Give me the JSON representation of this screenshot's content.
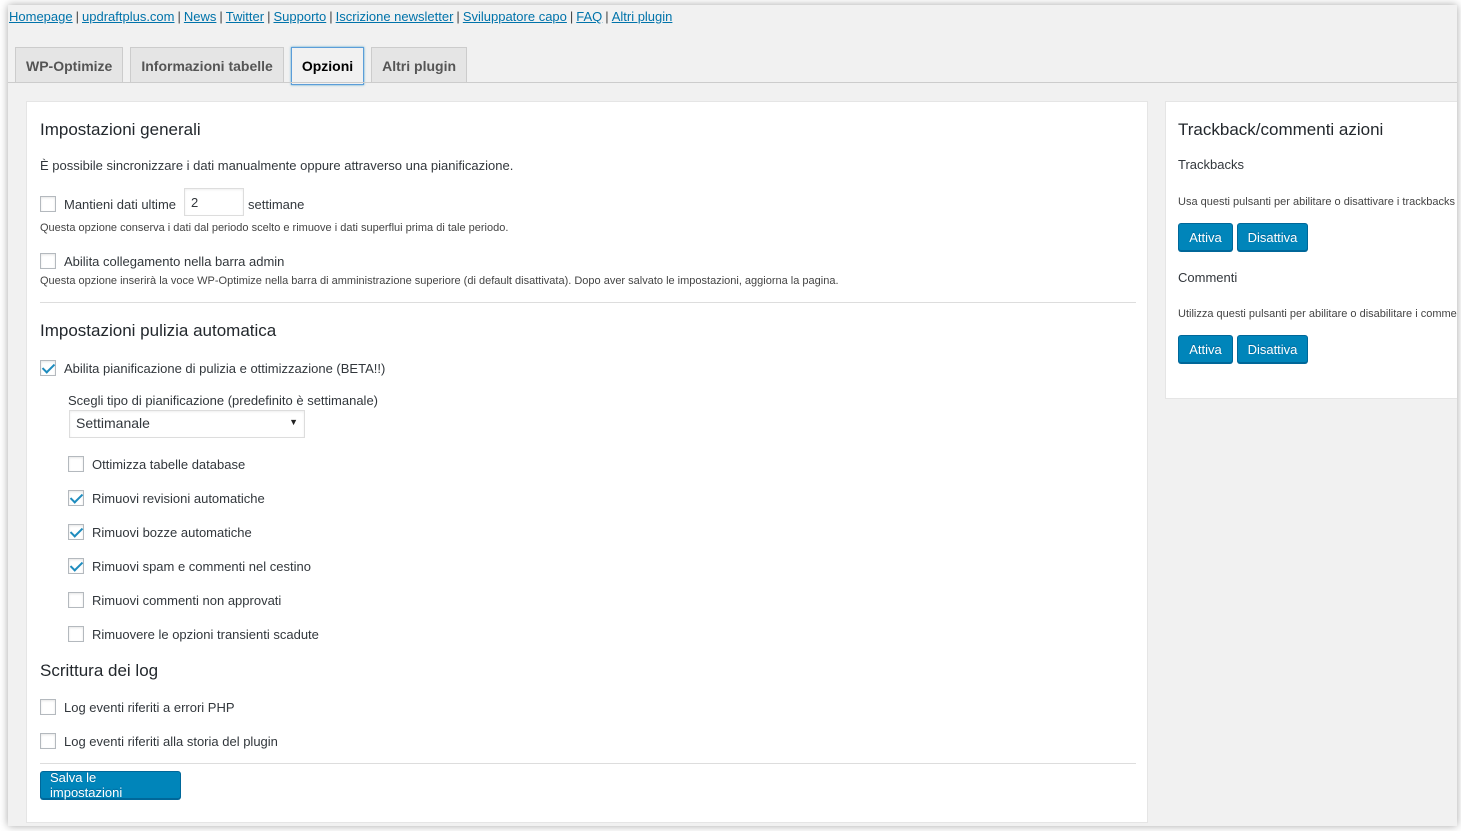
{
  "top_links": [
    "Homepage",
    "updraftplus.com",
    "News",
    "Twitter",
    "Supporto",
    "Iscrizione newsletter",
    "Sviluppatore capo",
    "FAQ",
    "Altri plugin"
  ],
  "tabs": [
    {
      "label": "WP-Optimize",
      "active": false
    },
    {
      "label": "Informazioni tabelle",
      "active": false
    },
    {
      "label": "Opzioni",
      "active": true
    },
    {
      "label": "Altri plugin",
      "active": false
    }
  ],
  "general": {
    "title": "Impostazioni generali",
    "intro": "È possibile sincronizzare i dati manualmente oppure attraverso una pianificazione.",
    "keep_prefix": "Mantieni dati ultime",
    "keep_value": "2",
    "keep_suffix": "settimane",
    "keep_desc": "Questa opzione conserva i dati dal periodo scelto e rimuove i dati superflui prima di tale periodo.",
    "admin_bar_label": "Abilita collegamento nella barra admin",
    "admin_bar_desc": "Questa opzione inserirà la voce WP-Optimize nella barra di amministrazione superiore (di default disattivata). Dopo aver salvato le impostazioni, aggiorna la pagina."
  },
  "auto": {
    "title": "Impostazioni pulizia automatica",
    "enable_label": "Abilita pianificazione di pulizia e ottimizzazione (BETA!!)",
    "schedule_label": "Scegli tipo di pianificazione (predefinito è settimanale)",
    "schedule_value": "Settimanale",
    "options": [
      {
        "label": "Ottimizza tabelle database",
        "checked": false
      },
      {
        "label": "Rimuovi revisioni automatiche",
        "checked": true
      },
      {
        "label": "Rimuovi bozze automatiche",
        "checked": true
      },
      {
        "label": "Rimuovi spam e commenti nel cestino",
        "checked": true
      },
      {
        "label": "Rimuovi commenti non approvati",
        "checked": false
      },
      {
        "label": "Rimuovere le opzioni transienti scadute",
        "checked": false
      }
    ]
  },
  "logging": {
    "title": "Scrittura dei log",
    "php_errors": "Log eventi riferiti a errori PHP",
    "plugin_history": "Log eventi riferiti alla storia del plugin"
  },
  "save_button": "Salva le impostazioni",
  "sidebar": {
    "title": "Trackback/commenti azioni",
    "trackbacks_heading": "Trackbacks",
    "trackbacks_desc": "Usa questi pulsanti per abilitare o disattivare i trackbacks fu",
    "comments_heading": "Commenti",
    "comments_desc": "Utilizza questi pulsanti per abilitare o disabilitare i commen",
    "enable_label": "Attiva",
    "disable_label": "Disattiva"
  },
  "colors": {
    "primary_button": "#0085ba",
    "link": "#0073aa",
    "checkmark": "#1e8cbe"
  }
}
